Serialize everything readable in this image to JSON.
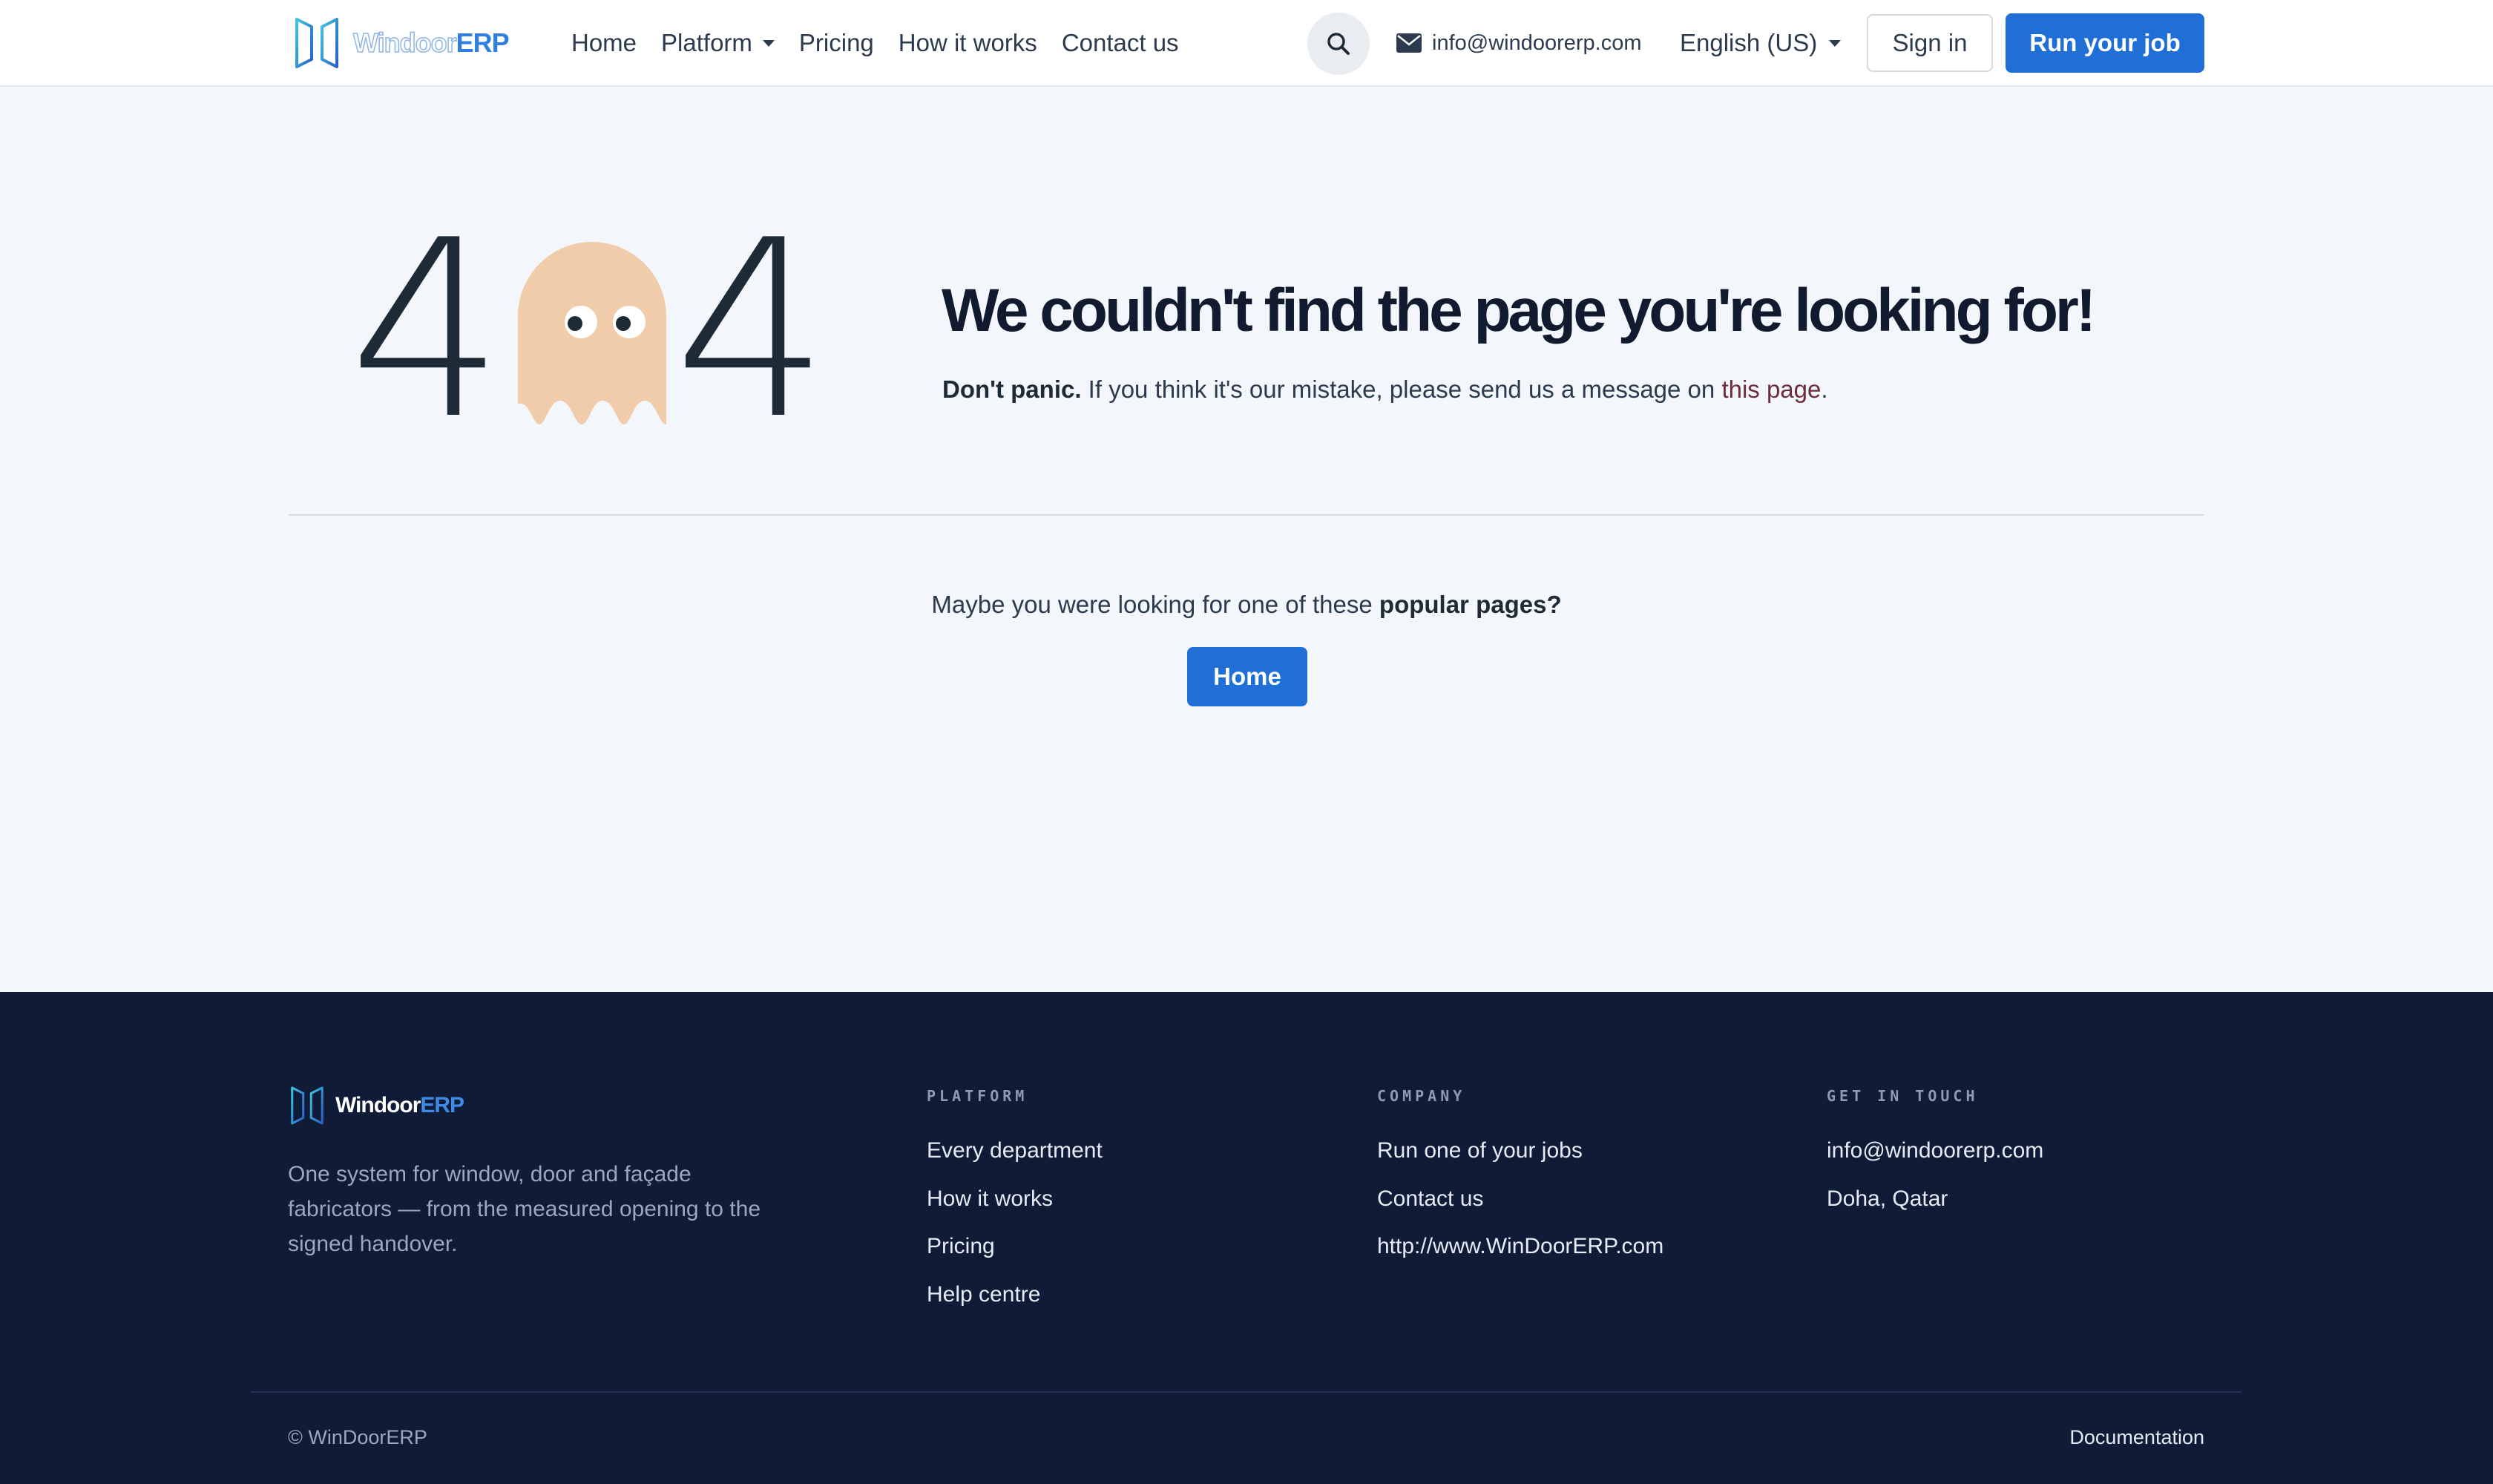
{
  "header": {
    "brand": {
      "part1": "Windoor",
      "part2": "ERP"
    },
    "nav": [
      {
        "label": "Home"
      },
      {
        "label": "Platform",
        "has_dropdown": true
      },
      {
        "label": "Pricing"
      },
      {
        "label": "How it works"
      },
      {
        "label": "Contact us"
      }
    ],
    "email": "info@windoorerp.com",
    "language": "English (US)",
    "sign_in": "Sign in",
    "cta": "Run your job"
  },
  "error": {
    "code_left": "4",
    "code_right": "4",
    "headline": "We couldn't find the page you're looking for!",
    "lead_bold": "Don't panic.",
    "lead_text": " If you think it's our mistake, please send us a message on ",
    "lead_link": "this page",
    "lead_end": "."
  },
  "suggestions": {
    "text": "Maybe you were looking for one of these ",
    "bold": "popular pages?",
    "home_button": "Home"
  },
  "footer": {
    "brand": {
      "part1": "Windoor",
      "part2": "ERP"
    },
    "tagline": "One system for window, door and façade fabricators — from the measured opening to the signed handover.",
    "columns": [
      {
        "title": "PLATFORM",
        "links": [
          "Every department",
          "How it works",
          "Pricing",
          "Help centre"
        ]
      },
      {
        "title": "COMPANY",
        "links": [
          "Run one of your jobs",
          "Contact us",
          "http://www.WinDoorERP.com"
        ]
      },
      {
        "title": "GET IN TOUCH",
        "links": [
          "info@windoorerp.com",
          "Doha, Qatar"
        ]
      }
    ],
    "copyright": "© WinDoorERP",
    "docs_link": "Documentation"
  },
  "colors": {
    "primary": "#1f6fd6",
    "footer_bg": "#101c37",
    "page_bg": "#f3f7fc",
    "ghost": "#f1ccaa",
    "link_maroon": "#6e2d3a"
  },
  "icons": [
    "windoor-logo-icon",
    "search-icon",
    "envelope-icon",
    "chevron-down-icon",
    "ghost-icon"
  ]
}
